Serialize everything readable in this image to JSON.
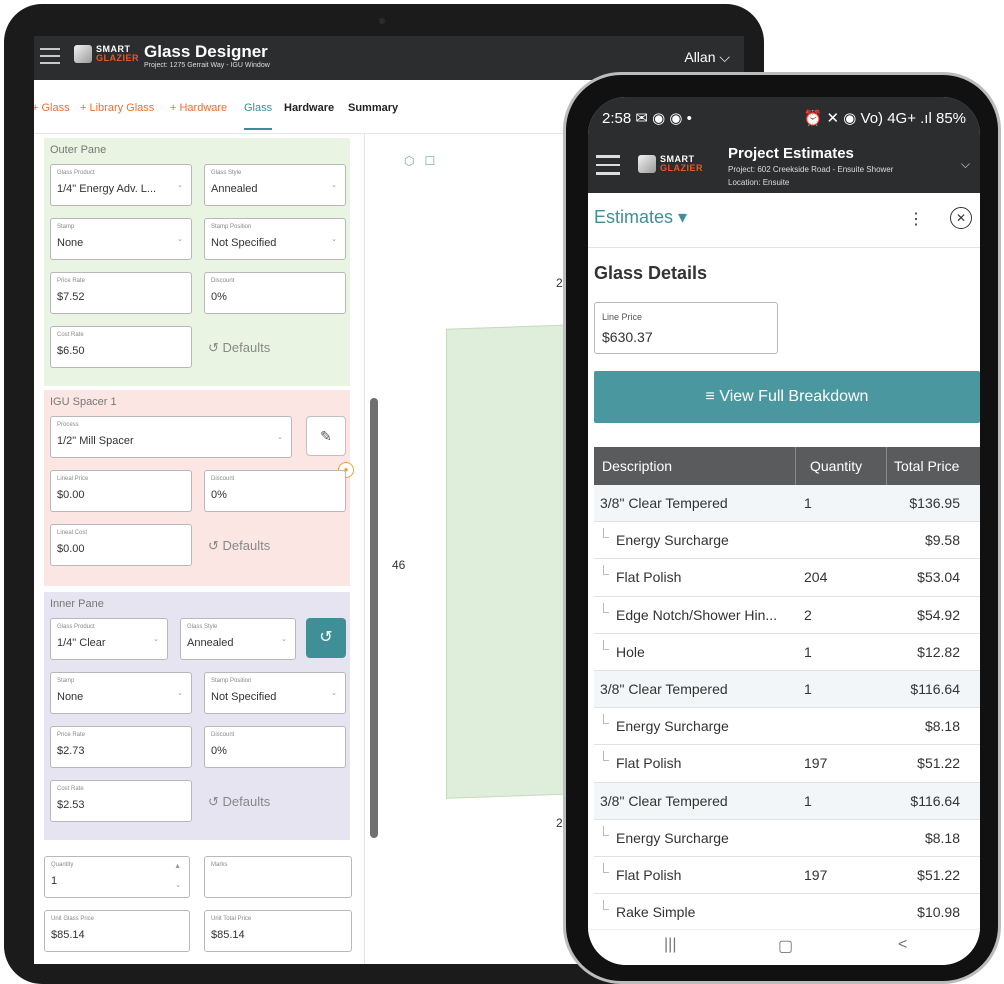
{
  "tablet": {
    "brand": {
      "line1": "SMART",
      "line2": "GLAZIER"
    },
    "title": "Glass Designer",
    "subtitle": "Project: 1275 Gerrait Way - IGU Window",
    "user": "Allan ⌵",
    "nav": [
      "+ Glass",
      "+ Library Glass",
      "+ Hardware",
      "Glass",
      "Hardware",
      "Summary"
    ],
    "outer_pane": {
      "title": "Outer Pane",
      "glass_product": {
        "label": "Glass Product",
        "value": "1/4\" Energy Adv. L..."
      },
      "glass_style": {
        "label": "Glass Style",
        "value": "Annealed"
      },
      "stamp": {
        "label": "Stamp",
        "value": "None"
      },
      "stamp_position": {
        "label": "Stamp Position",
        "value": "Not Specified"
      },
      "price_rate": {
        "label": "Price Rate",
        "value": "$7.52"
      },
      "discount": {
        "label": "Discount",
        "value": "0%"
      },
      "cost_rate": {
        "label": "Cost Rate",
        "value": "$6.50"
      },
      "defaults": "Defaults"
    },
    "igu_spacer": {
      "title": "IGU Spacer 1",
      "process": {
        "label": "Process",
        "value": "1/2\" Mill Spacer"
      },
      "lineal_price": {
        "label": "Lineal Price",
        "value": "$0.00"
      },
      "discount": {
        "label": "Discount",
        "value": "0%"
      },
      "lineal_cost": {
        "label": "Lineal Cost",
        "value": "$0.00"
      },
      "defaults": "Defaults"
    },
    "inner_pane": {
      "title": "Inner Pane",
      "glass_product": {
        "label": "Glass Product",
        "value": "1/4\" Clear"
      },
      "glass_style": {
        "label": "Glass Style",
        "value": "Annealed"
      },
      "stamp": {
        "label": "Stamp",
        "value": "None"
      },
      "stamp_position": {
        "label": "Stamp Position",
        "value": "Not Specified"
      },
      "price_rate": {
        "label": "Price Rate",
        "value": "$2.73"
      },
      "discount": {
        "label": "Discount",
        "value": "0%"
      },
      "cost_rate": {
        "label": "Cost Rate",
        "value": "$2.53"
      },
      "defaults": "Defaults"
    },
    "quantity": {
      "label": "Quantity",
      "value": "1"
    },
    "marks": {
      "label": "Marks",
      "value": ""
    },
    "unit_glass_price": {
      "label": "Unit Glass Price",
      "value": "$85.14"
    },
    "unit_total_price": {
      "label": "Unit Total Price",
      "value": "$85.14"
    },
    "dims": {
      "left": "46",
      "top": "2",
      "bottom": "2"
    }
  },
  "phone": {
    "status_time": "2:58 ✉ ◉ ◉ •",
    "status_right": "⏰ ✕ ◉ Vo) 4G+ .ıl 85%",
    "brand": {
      "line1": "SMART",
      "line2": "GLAZIER"
    },
    "title": "Project Estimates",
    "project": "Project: 602 Creekside Road - Ensuite Shower",
    "location": "Location: Ensuite",
    "estimates_label": "Estimates ▾",
    "section_title": "Glass Details",
    "line_price": {
      "label": "Line Price",
      "value": "$630.37"
    },
    "breakdown_button": "View Full Breakdown",
    "table": {
      "headers": [
        "Description",
        "Quantity",
        "Total Price"
      ],
      "rows": [
        {
          "desc": "3/8\" Clear Tempered",
          "qty": "1",
          "price": "$136.95",
          "sub": false
        },
        {
          "desc": "Energy Surcharge",
          "qty": "",
          "price": "$9.58",
          "sub": true
        },
        {
          "desc": "Flat Polish",
          "qty": "204",
          "price": "$53.04",
          "sub": true
        },
        {
          "desc": "Edge Notch/Shower Hin...",
          "qty": "2",
          "price": "$54.92",
          "sub": true
        },
        {
          "desc": "Hole",
          "qty": "1",
          "price": "$12.82",
          "sub": true
        },
        {
          "desc": "3/8\" Clear Tempered",
          "qty": "1",
          "price": "$116.64",
          "sub": false
        },
        {
          "desc": "Energy Surcharge",
          "qty": "",
          "price": "$8.18",
          "sub": true
        },
        {
          "desc": "Flat Polish",
          "qty": "197",
          "price": "$51.22",
          "sub": true
        },
        {
          "desc": "3/8\" Clear Tempered",
          "qty": "1",
          "price": "$116.64",
          "sub": false
        },
        {
          "desc": "Energy Surcharge",
          "qty": "",
          "price": "$8.18",
          "sub": true
        },
        {
          "desc": "Flat Polish",
          "qty": "197",
          "price": "$51.22",
          "sub": true
        },
        {
          "desc": "Rake Simple",
          "qty": "",
          "price": "$10.98",
          "sub": true
        }
      ]
    },
    "nav": {
      "recent": "|||",
      "home": "▢",
      "back": "<"
    }
  },
  "colors": {
    "accent": "#3f8f97",
    "brand_orange": "#e8572a"
  }
}
